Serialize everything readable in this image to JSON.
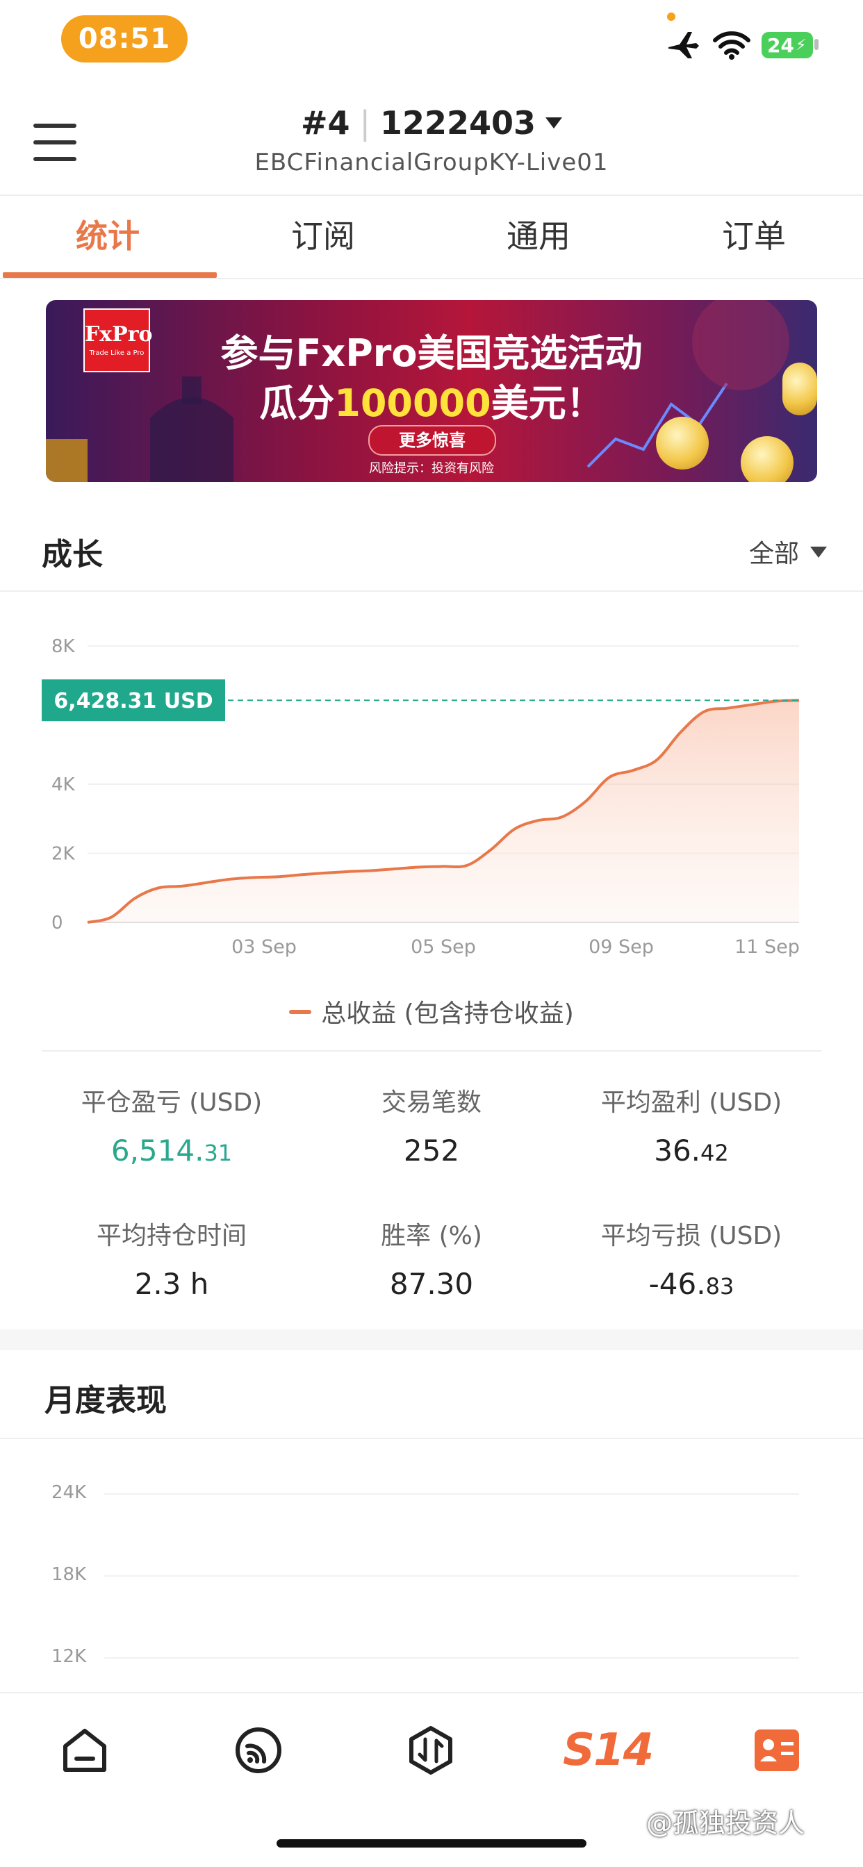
{
  "status_bar": {
    "time": "08:51",
    "battery": "24"
  },
  "header": {
    "account_no": "#4",
    "account_id": "1222403",
    "server": "EBCFinancialGroupKY-Live01"
  },
  "tabs": [
    {
      "label": "统计",
      "active": true
    },
    {
      "label": "订阅",
      "active": false
    },
    {
      "label": "通用",
      "active": false
    },
    {
      "label": "订单",
      "active": false
    }
  ],
  "banner": {
    "logo": "FxPro",
    "logo_tag": "Trade Like a Pro",
    "line1": "参与FxPro美国竞选活动",
    "line2_a": "瓜分",
    "line2_amount": "100000",
    "line2_b": "美元！",
    "button": "更多惊喜",
    "risk": "风险提示：投资有风险"
  },
  "growth": {
    "title": "成长",
    "range_label": "全部"
  },
  "chart_data": {
    "type": "area",
    "x_tick_labels": [
      "03 Sep",
      "05 Sep",
      "09 Sep",
      "11 Sep"
    ],
    "y_tick_labels": [
      "8K",
      "4K",
      "2K",
      "0"
    ],
    "ylim": [
      0,
      8000
    ],
    "series": [
      {
        "name": "总收益 (包含持仓收益)",
        "color": "#e8784a",
        "values": [
          0,
          150,
          700,
          1000,
          1050,
          1150,
          1250,
          1300,
          1320,
          1380,
          1430,
          1470,
          1500,
          1550,
          1600,
          1620,
          1650,
          2100,
          2700,
          2950,
          3050,
          3500,
          4200,
          4400,
          4700,
          5500,
          6100,
          6200,
          6300,
          6400,
          6428.31
        ]
      }
    ],
    "current_value_label": "6,428.31 USD",
    "current_value": 6428.31,
    "legend": "总收益 (包含持仓收益)"
  },
  "stats": [
    {
      "label": "平仓盈亏 (USD)",
      "int": "6,514.",
      "dec": "31",
      "color": "#29a88e"
    },
    {
      "label": "交易笔数",
      "int": "252",
      "dec": ""
    },
    {
      "label": "平均盈利 (USD)",
      "int": "36.",
      "dec": "42"
    },
    {
      "label": "平均持仓时间",
      "int": "2.3 h",
      "dec": ""
    },
    {
      "label": "胜率 (%)",
      "int": "87.30",
      "dec": ""
    },
    {
      "label": "平均亏损 (USD)",
      "int": "-46.",
      "dec": "83"
    }
  ],
  "monthly": {
    "title": "月度表现",
    "y_tick_labels": [
      "24K",
      "18K",
      "12K"
    ]
  },
  "bottom_nav": {
    "items": [
      {
        "icon": "home-icon"
      },
      {
        "icon": "signal-icon"
      },
      {
        "icon": "trade-icon"
      },
      {
        "icon": "s14-icon",
        "label": "S14"
      },
      {
        "icon": "profile-card-icon"
      }
    ]
  },
  "watermark": "@孤独投资人"
}
